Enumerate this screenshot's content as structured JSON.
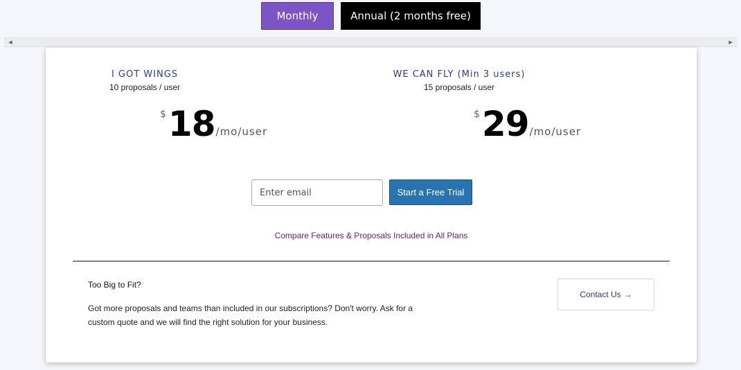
{
  "billing_toggle": {
    "monthly_label": "Monthly",
    "annual_label": "Annual (2 months free)"
  },
  "plans": [
    {
      "name": "I GOT WINGS",
      "subtitle": "10 proposals / user",
      "currency": "$",
      "price": "18",
      "period": "/mo/user"
    },
    {
      "name": "WE CAN FLY (Min 3 users)",
      "subtitle": "15 proposals / user",
      "currency": "$",
      "price": "29",
      "period": "/mo/user"
    }
  ],
  "signup": {
    "email_placeholder": "Enter email",
    "email_value": "",
    "trial_button_label": "Start a Free Trial"
  },
  "compare_link": "Compare Features & Proposals Included in All Plans",
  "enterprise": {
    "title": "Too Big to Fit?",
    "description": "Got more proposals and teams than included in our subscriptions? Don't worry. Ask for a custom quote and we will find the right solution for your business.",
    "contact_label": "Contact Us",
    "contact_icon": "arrow-right-icon"
  },
  "scrollbar": {
    "left_icon": "scroll-left-arrow-icon",
    "right_icon": "scroll-right-arrow-icon"
  },
  "colors": {
    "monthly_active": "#7b55c6",
    "annual": "#000000",
    "plan_name": "#2b3a9c",
    "trial_button": "#2874b0",
    "link": "#6a1d6a"
  }
}
